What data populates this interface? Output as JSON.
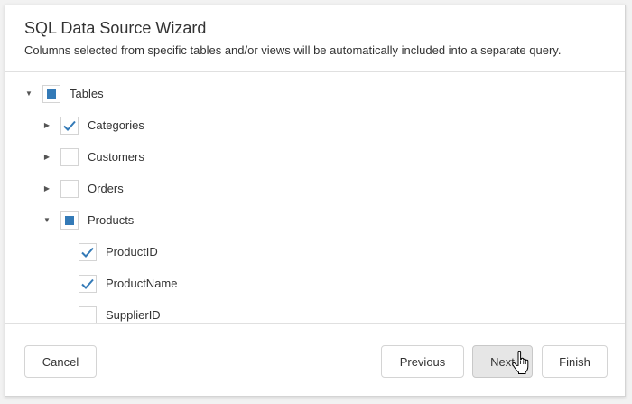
{
  "dialog": {
    "title": "SQL Data Source Wizard",
    "subtitle": "Columns selected from specific tables and/or views will be automatically included into a separate query."
  },
  "tree": {
    "root": {
      "label": "Tables",
      "state": "indeterminate",
      "expanded": true
    },
    "tables": [
      {
        "label": "Categories",
        "state": "checked",
        "expanded": false
      },
      {
        "label": "Customers",
        "state": "unchecked",
        "expanded": false
      },
      {
        "label": "Orders",
        "state": "unchecked",
        "expanded": false
      },
      {
        "label": "Products",
        "state": "indeterminate",
        "expanded": true
      }
    ],
    "product_columns": [
      {
        "label": "ProductID",
        "state": "checked"
      },
      {
        "label": "ProductName",
        "state": "checked"
      },
      {
        "label": "SupplierID",
        "state": "unchecked"
      }
    ]
  },
  "footer": {
    "cancel_label": "Cancel",
    "previous_label": "Previous",
    "next_label": "Next",
    "finish_label": "Finish"
  },
  "colors": {
    "accent": "#337ab7",
    "check": "#337ab7",
    "border": "#d4d4d4",
    "pressed_button": "#e6e6e6"
  },
  "cursor": "hand-pointer-icon"
}
